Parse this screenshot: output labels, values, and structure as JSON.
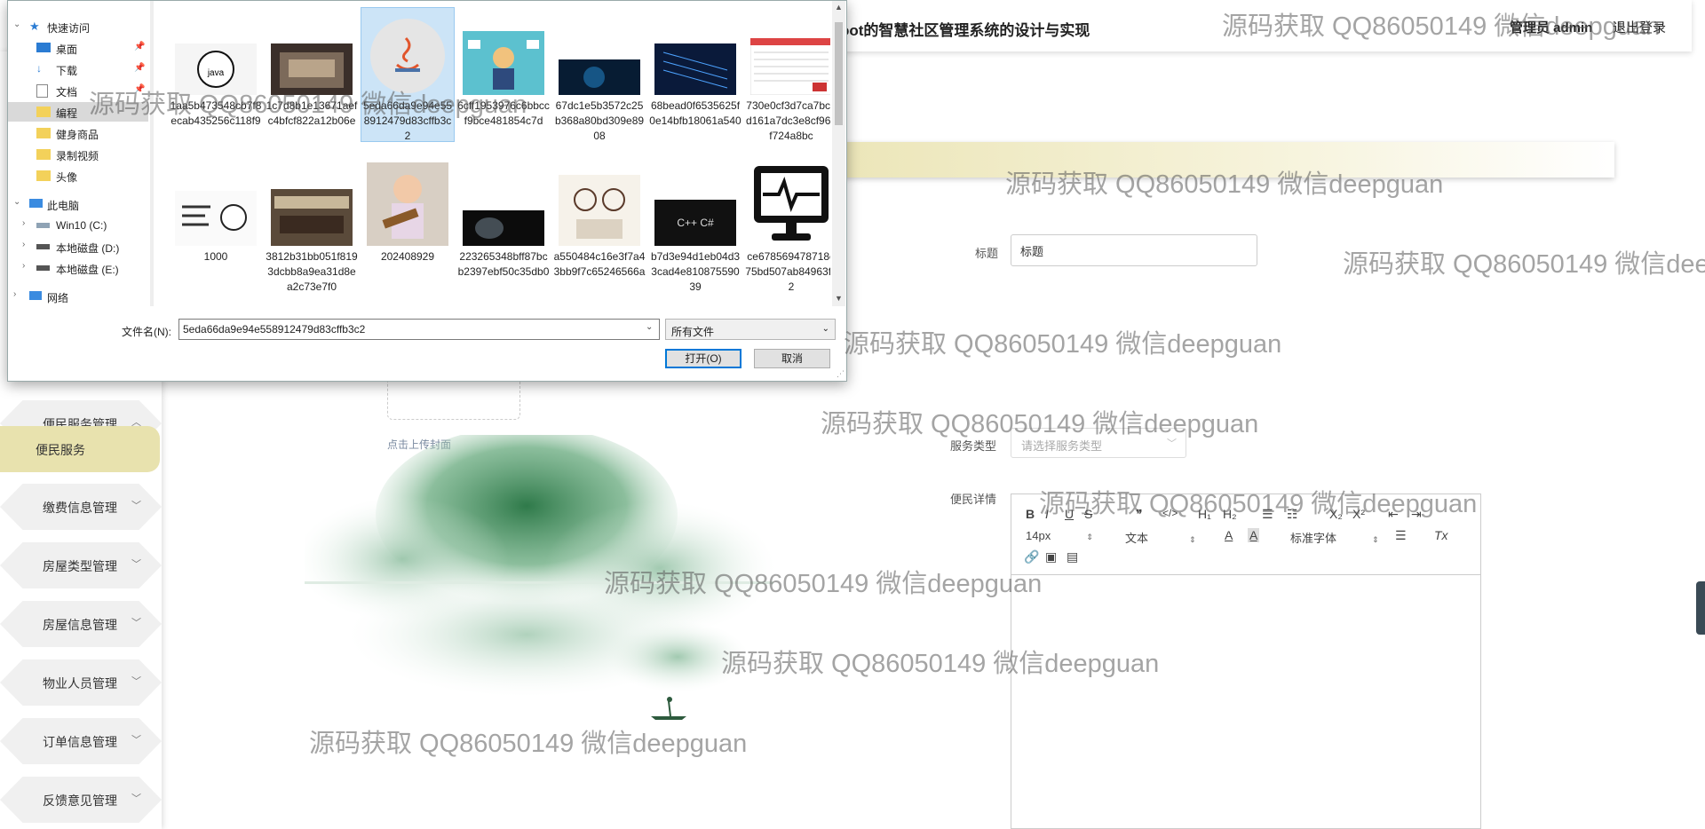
{
  "header": {
    "site_title": "oot的智慧社区管理系统的设计与实现",
    "user_info": "管理员 admin",
    "logout": "退出登录"
  },
  "sidebar": {
    "items": [
      {
        "label": "便民服务管理",
        "chevron": "︿"
      },
      {
        "label": "便民服务",
        "active": true
      },
      {
        "label": "缴费信息管理",
        "chevron": "﹀"
      },
      {
        "label": "房屋类型管理",
        "chevron": "﹀"
      },
      {
        "label": "房屋信息管理",
        "chevron": "﹀"
      },
      {
        "label": "物业人员管理",
        "chevron": "﹀"
      },
      {
        "label": "订单信息管理",
        "chevron": "﹀"
      },
      {
        "label": "反馈意见管理",
        "chevron": "﹀"
      }
    ]
  },
  "form": {
    "title_label": "标题",
    "title_value": "标题",
    "upload_hint": "点击上传封面",
    "service_type_label": "服务类型",
    "service_type_placeholder": "请选择服务类型",
    "detail_label": "便民详情"
  },
  "editor": {
    "toolbar_row1": [
      "B",
      "I",
      "U",
      "S",
      "❞",
      "</>",
      "H₁",
      "H₂",
      "☰",
      "☷",
      "X₂",
      "X²",
      "⇤",
      "⇥"
    ],
    "font_size": "14px",
    "paragraph": "文本",
    "font_family": "标准字体",
    "color_icon": "A",
    "bg_icon": "A̲",
    "align_icon": "☰",
    "clear_icon": "Tx"
  },
  "watermark_text": "源码获取 QQ86050149 微信deepguan",
  "dialog": {
    "nav": [
      {
        "label": "快速访问",
        "icon": "star-icon",
        "expander": "⌄"
      },
      {
        "label": "桌面",
        "icon": "desktop-icon",
        "pinned": true
      },
      {
        "label": "下载",
        "icon": "download-icon",
        "pinned": true
      },
      {
        "label": "文档",
        "icon": "document-icon",
        "pinned": true
      },
      {
        "label": "编程",
        "icon": "folder-icon",
        "selected": true
      },
      {
        "label": "健身商品",
        "icon": "folder-icon"
      },
      {
        "label": "录制视频",
        "icon": "folder-icon"
      },
      {
        "label": "头像",
        "icon": "folder-icon"
      },
      {
        "label": "此电脑",
        "icon": "computer-icon",
        "expander": "⌄"
      },
      {
        "label": "Win10 (C:)",
        "icon": "drive-icon",
        "expander": "›"
      },
      {
        "label": "本地磁盘 (D:)",
        "icon": "drive-icon",
        "expander": "›"
      },
      {
        "label": "本地磁盘 (E:)",
        "icon": "drive-icon",
        "expander": "›"
      },
      {
        "label": "网络",
        "icon": "network-icon",
        "expander": "›"
      }
    ],
    "files": [
      {
        "name": "1aa5b473548cb7f8ecab435256c118f9",
        "thumb": "java-logo"
      },
      {
        "name": "1c7d8b1e13671aefc4bfcf822a12b06e",
        "thumb": "laptop-photo"
      },
      {
        "name": "5eda66da9e94e558912479d83cffb3c2",
        "thumb": "java-cup-logo",
        "selected": true
      },
      {
        "name": "6cff1953976c6bbccf9bce481854c7d",
        "thumb": "multitask-illustration"
      },
      {
        "name": "67dc1e5b3572c25b368a80bd309e8908",
        "thumb": "tech-head"
      },
      {
        "name": "68bead0f6535625f0e14bfb18061a540",
        "thumb": "code-wall"
      },
      {
        "name": "730e0cf3d7ca7bcbd161a7dc3e8cf964f724a8bc",
        "thumb": "spreadsheet"
      },
      {
        "name": "1000",
        "thumb": "cartoon-text"
      },
      {
        "name": "3812b31bb051f8193dcbb8a9ea31d8ea2c73e7f0",
        "thumb": "meeting-room"
      },
      {
        "name": "202408929",
        "thumb": "baby-guitar"
      },
      {
        "name": "223265348bff87bcb2397ebf50c35db0",
        "thumb": "dark-face"
      },
      {
        "name": "a550484c16e3f7a43bb9f7c65246566a",
        "thumb": "sketch-people"
      },
      {
        "name": "b7d3e94d1eb04d33cad4e81087559039",
        "thumb": "cpp-cloud"
      },
      {
        "name": "ce678569478718e75bd507ab84963f32",
        "thumb": "monitor-icon"
      }
    ],
    "filename_label": "文件名(N):",
    "filename_value": "5eda66da9e94e558912479d83cffb3c2",
    "filetype": "所有文件",
    "open_button": "打开(O)",
    "cancel_button": "取消"
  }
}
